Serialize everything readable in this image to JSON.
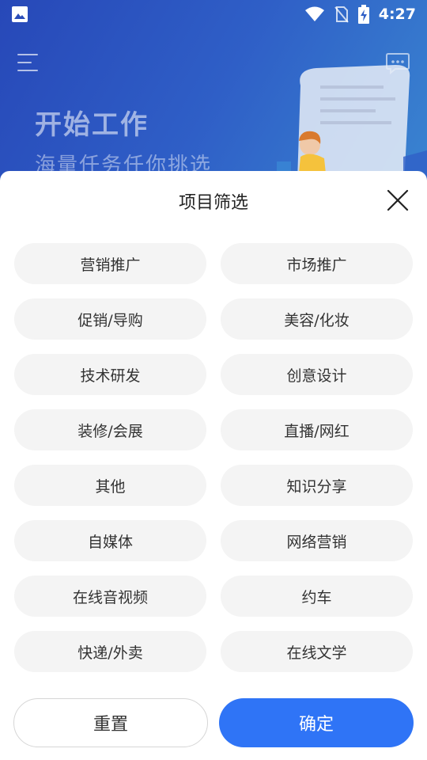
{
  "status_bar": {
    "time": "4:27",
    "icons": [
      "image-icon",
      "wifi-icon",
      "no-sim-icon",
      "battery-charging-icon"
    ]
  },
  "banner": {
    "title": "开始工作",
    "subtitle": "海量任务任你挑选",
    "icons": [
      "menu-icon",
      "chat-icon"
    ]
  },
  "sheet": {
    "title": "项目筛选",
    "close_icon": "close-icon",
    "categories": [
      "营销推广",
      "市场推广",
      "促销/导购",
      "美容/化妆",
      "技术研发",
      "创意设计",
      "装修/会展",
      "直播/网红",
      "其他",
      "知识分享",
      "自媒体",
      "网络营销",
      "在线音视频",
      "约车",
      "快递/外卖",
      "在线文学"
    ],
    "reset_label": "重置",
    "confirm_label": "确定"
  },
  "colors": {
    "accent": "#2f74f6",
    "chip_bg": "#f4f4f4",
    "banner_start": "#2748b8",
    "banner_end": "#3a86d1"
  }
}
